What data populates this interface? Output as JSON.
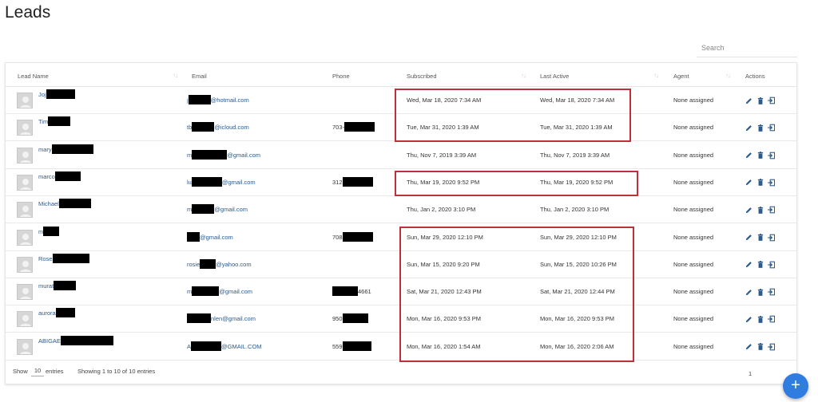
{
  "page": {
    "title": "Leads"
  },
  "search": {
    "placeholder": "Search"
  },
  "table": {
    "columns": {
      "lead_name": "Lead Name",
      "email": "Email",
      "phone": "Phone",
      "subscribed": "Subscribed",
      "last_active": "Last Active",
      "agent": "Agent",
      "actions": "Actions"
    },
    "rows": [
      {
        "name": "Joj",
        "email_prefix": "j",
        "email_suffix": "@hotmail.com",
        "phone": "",
        "subscribed": "Wed, Mar 18, 2020 7:34 AM",
        "last_active": "Wed, Mar 18, 2020 7:34 AM",
        "agent": "None assigned"
      },
      {
        "name": "Tim",
        "email_prefix": "tb",
        "email_suffix": "@icloud.com",
        "phone": "703-",
        "subscribed": "Tue, Mar 31, 2020 1:39 AM",
        "last_active": "Tue, Mar 31, 2020 1:39 AM",
        "agent": "None assigned"
      },
      {
        "name": "mary",
        "email_prefix": "m",
        "email_suffix": "@gmail.com",
        "phone": "",
        "subscribed": "Thu, Nov 7, 2019 3:39 AM",
        "last_active": "Thu, Nov 7, 2019 3:39 AM",
        "agent": "None assigned"
      },
      {
        "name": "marco",
        "email_prefix": "lu",
        "email_suffix": "@gmail.com",
        "phone": "312",
        "subscribed": "Thu, Mar 19, 2020 9:52 PM",
        "last_active": "Thu, Mar 19, 2020 9:52 PM",
        "agent": "None assigned"
      },
      {
        "name": "Michael",
        "email_prefix": "m",
        "email_suffix": "@gmail.com",
        "phone": "",
        "subscribed": "Thu, Jan 2, 2020 3:10 PM",
        "last_active": "Thu, Jan 2, 2020 3:10 PM",
        "agent": "None assigned"
      },
      {
        "name": "m",
        "email_prefix": "",
        "email_suffix": "@gmail.com",
        "phone": "708",
        "subscribed": "Sun, Mar 29, 2020 12:10 PM",
        "last_active": "Sun, Mar 29, 2020 12:10 PM",
        "agent": "None assigned"
      },
      {
        "name": "Rose",
        "email_prefix": "rosie",
        "email_suffix": "@yahoo.com",
        "phone": "",
        "subscribed": "Sun, Mar 15, 2020 9:20 PM",
        "last_active": "Sun, Mar 15, 2020 10:26 PM",
        "agent": "None assigned"
      },
      {
        "name": "murat",
        "email_prefix": "m",
        "email_suffix": "@gmail.com",
        "phone": "4661",
        "subscribed": "Sat, Mar 21, 2020 12:43 PM",
        "last_active": "Sat, Mar 21, 2020 12:44 PM",
        "agent": "None assigned"
      },
      {
        "name": "aurora",
        "email_prefix": "",
        "email_suffix": "nlen@gmail.com",
        "phone": "950",
        "subscribed": "Mon, Mar 16, 2020 9:53 PM",
        "last_active": "Mon, Mar 16, 2020 9:53 PM",
        "agent": "None assigned"
      },
      {
        "name": "ABIGAE",
        "email_prefix": "A",
        "email_suffix": "@GMAIL.COM",
        "phone": "559",
        "subscribed": "Mon, Mar 16, 2020 1:54 AM",
        "last_active": "Mon, Mar 16, 2020 2:06 AM",
        "agent": "None assigned"
      }
    ]
  },
  "footer": {
    "show_label": "Show",
    "page_length": "10",
    "entries_label": "entries",
    "info": "Showing 1 to 10 of 10 entries",
    "current_page": "1"
  },
  "fab": {
    "label": "+"
  },
  "colors": {
    "link": "#2c5a8c",
    "highlight": "#c0303a",
    "fab": "#2f7de1",
    "icon": "#2c5a8c"
  }
}
